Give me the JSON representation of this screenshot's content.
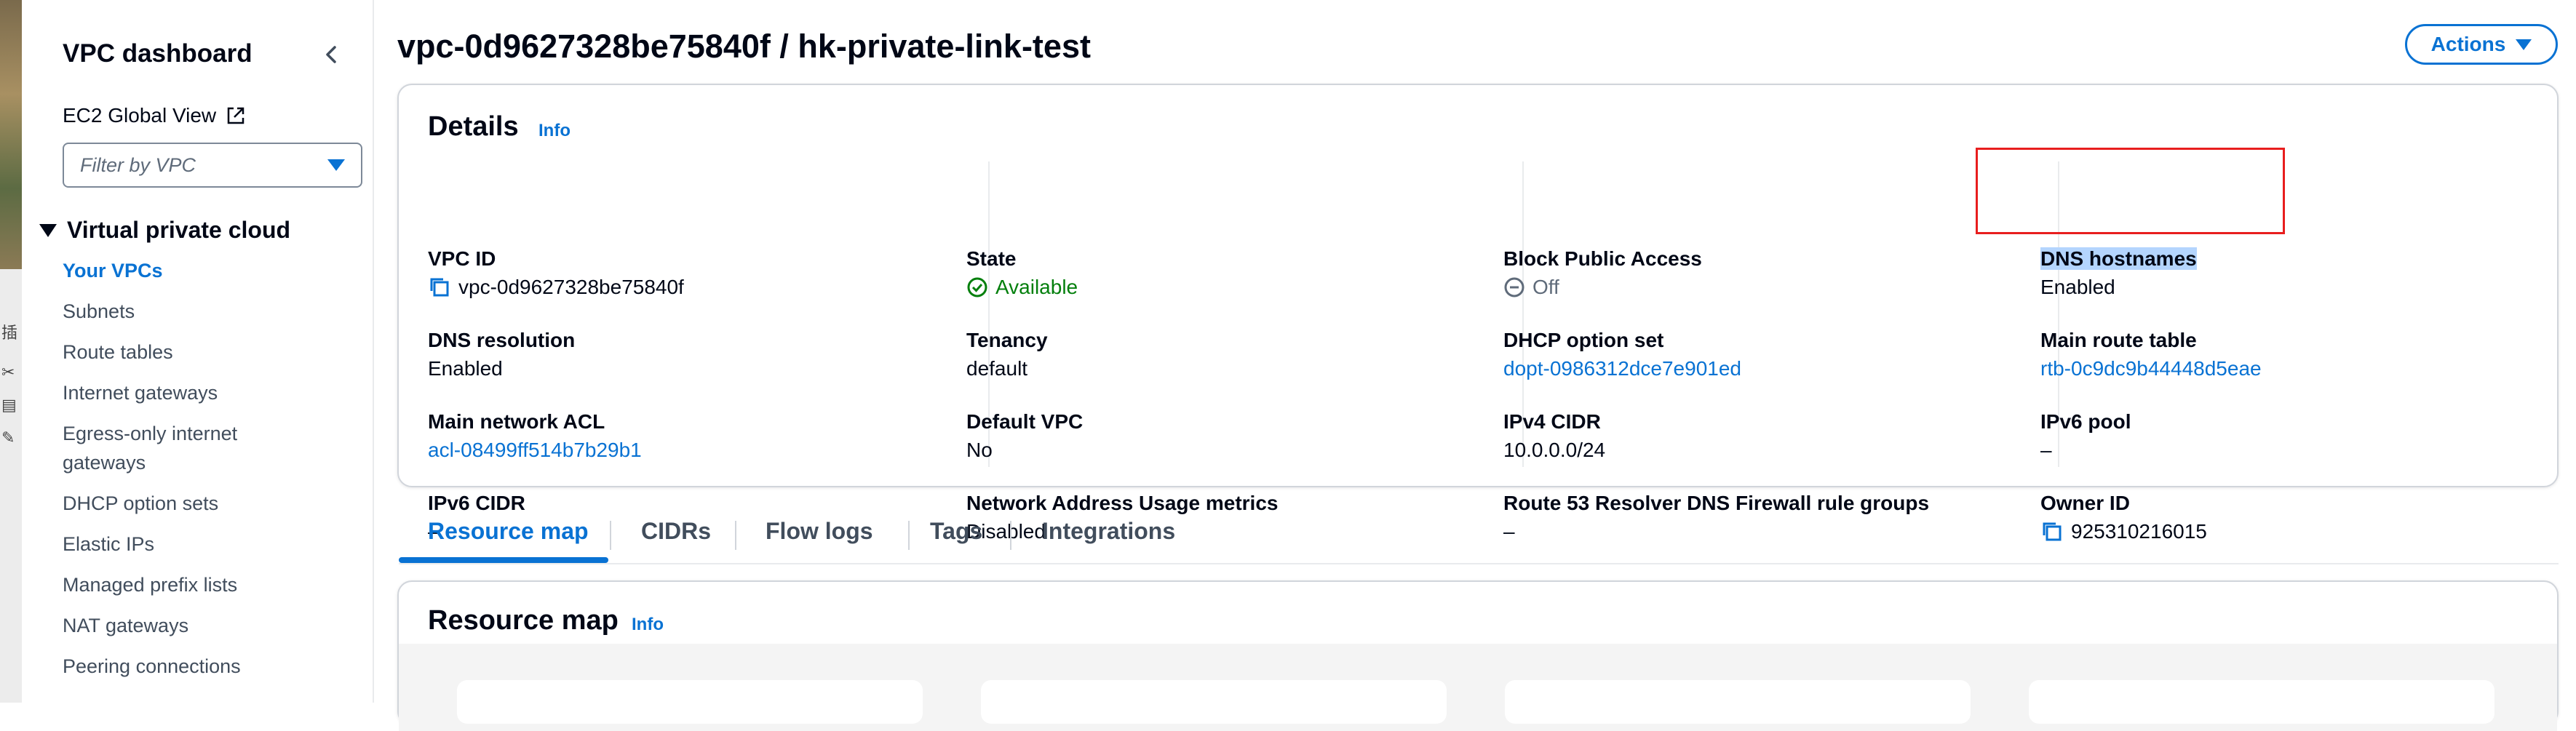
{
  "sidebar": {
    "title": "VPC dashboard",
    "ec2_global_view": "EC2 Global View",
    "filter": {
      "placeholder": "Filter by VPC"
    },
    "section": "Virtual private cloud",
    "items": [
      {
        "label": "Your VPCs",
        "active": true
      },
      {
        "label": "Subnets"
      },
      {
        "label": "Route tables"
      },
      {
        "label": "Internet gateways"
      },
      {
        "label": "Egress-only internet gateways"
      },
      {
        "label": "DHCP option sets"
      },
      {
        "label": "Elastic IPs"
      },
      {
        "label": "Managed prefix lists"
      },
      {
        "label": "NAT gateways"
      },
      {
        "label": "Peering connections"
      }
    ]
  },
  "page": {
    "title": "vpc-0d9627328be75840f / hk-private-link-test",
    "actions_label": "Actions"
  },
  "details": {
    "heading": "Details",
    "info": "Info",
    "col1": {
      "vpc_id": {
        "label": "VPC ID",
        "value": "vpc-0d9627328be75840f"
      },
      "dns_resolution": {
        "label": "DNS resolution",
        "value": "Enabled"
      },
      "main_network_acl": {
        "label": "Main network ACL",
        "value": "acl-08499ff514b7b29b1"
      },
      "ipv6_cidr": {
        "label": "IPv6 CIDR",
        "value": "–"
      }
    },
    "col2": {
      "state": {
        "label": "State",
        "value": "Available"
      },
      "tenancy": {
        "label": "Tenancy",
        "value": "default"
      },
      "default_vpc": {
        "label": "Default VPC",
        "value": "No"
      },
      "nau_metrics": {
        "label": "Network Address Usage metrics",
        "value": "Disabled"
      }
    },
    "col3": {
      "block_public_access": {
        "label": "Block Public Access",
        "value": "Off"
      },
      "dhcp_option_set": {
        "label": "DHCP option set",
        "value": "dopt-0986312dce7e901ed"
      },
      "ipv4_cidr": {
        "label": "IPv4 CIDR",
        "value": "10.0.0.0/24"
      },
      "route53": {
        "label": "Route 53 Resolver DNS Firewall rule groups",
        "value": "–"
      }
    },
    "col4": {
      "dns_hostnames": {
        "label": "DNS hostnames",
        "value": "Enabled"
      },
      "main_route_table": {
        "label": "Main route table",
        "value": "rtb-0c9dc9b44448d5eae"
      },
      "ipv6_pool": {
        "label": "IPv6 pool",
        "value": "–"
      },
      "owner_id": {
        "label": "Owner ID",
        "value": "925310216015"
      }
    }
  },
  "tabs": [
    "Resource map",
    "CIDRs",
    "Flow logs",
    "Tags",
    "Integrations"
  ],
  "resource_map": {
    "heading": "Resource map",
    "info": "Info"
  },
  "colors": {
    "accent": "#0972d3",
    "success": "#037f0c",
    "text": "#000716",
    "highlight_box": "#e81e1e",
    "selection": "#b4d5fe"
  }
}
